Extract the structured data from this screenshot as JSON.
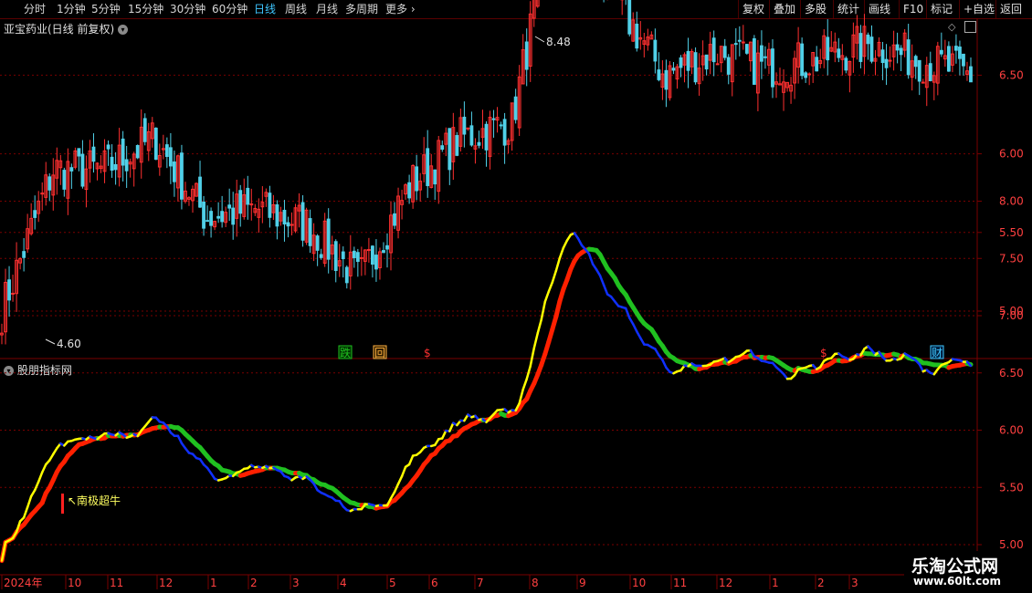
{
  "toolbar": {
    "periods": [
      "分时",
      "1分钟",
      "5分钟",
      "15分钟",
      "30分钟",
      "60分钟",
      "日线",
      "周线",
      "月线",
      "多周期",
      "更多"
    ],
    "active_period": "日线",
    "right_buttons": [
      "复权",
      "叠加",
      "多股",
      "统计",
      "画线",
      "F10",
      "标记",
      "+自选",
      "返回"
    ]
  },
  "main_panel": {
    "title": "亚宝药业(日线 前复权)",
    "high_label": "8.48",
    "low_label": "4.60",
    "event_markers": [
      "跌",
      "回",
      "$",
      "$",
      "财"
    ]
  },
  "indicator_panel": {
    "title": "股朋指标网",
    "signal_label": "南极超牛"
  },
  "axis": {
    "main_ticks": [
      "8.50",
      "8.00",
      "7.50",
      "7.00",
      "6.50",
      "6.00",
      "5.50",
      "5.00"
    ],
    "indicator_ticks": [
      "8.00",
      "7.50",
      "7.00",
      "6.50",
      "6.00",
      "5.50",
      "5.00"
    ],
    "date_labels": [
      "2024年",
      "10",
      "11",
      "12",
      "1",
      "2",
      "3",
      "4",
      "5",
      "6",
      "7",
      "8",
      "9",
      "10",
      "11",
      "12",
      "1",
      "2",
      "3"
    ]
  },
  "colors": {
    "up": "#ff3030",
    "down": "#50d0e8",
    "grid": "#7a0000",
    "axis_text": "#ff4040",
    "accent": "#3ec6ff",
    "ma_yellow": "#ffff00",
    "ma_blue": "#1030ff",
    "ma_red": "#ff2000",
    "ma_green": "#20c020"
  },
  "chart_data": {
    "type": "line",
    "title": "亚宝药业(日线 前复权)",
    "ylim": [
      4.5,
      8.6
    ],
    "x": [
      "2024-09",
      "2024-10",
      "2024-11",
      "2024-12",
      "2025-01",
      "2025-02",
      "2025-03",
      "2025-04",
      "2025-05",
      "2025-06",
      "2025-07",
      "2025-08",
      "2025-09",
      "2025-10",
      "2025-11",
      "2025-12",
      "2026-01",
      "2026-02",
      "2026-03",
      "2026-03-end"
    ],
    "series": [
      {
        "values": [
          5.0,
          5.9,
          5.9,
          6.1,
          5.6,
          5.65,
          5.55,
          5.2,
          5.8,
          6.1,
          6.2,
          7.8,
          7.0,
          6.5,
          6.65,
          6.55,
          6.6,
          6.7,
          6.6,
          6.5
        ]
      }
    ],
    "annotations": [
      "8.48",
      "4.60"
    ]
  }
}
